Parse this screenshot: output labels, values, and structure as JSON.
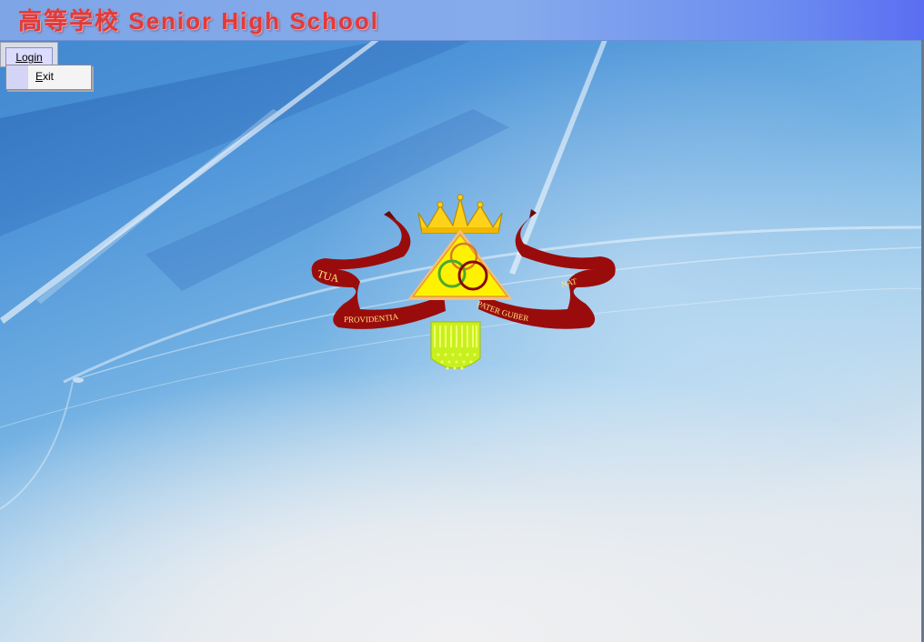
{
  "window": {
    "title": "高等学校 Senior High School"
  },
  "menu": {
    "login_label": "Login",
    "dropdown": {
      "exit_label_first": "E",
      "exit_label_rest": "xit"
    }
  },
  "crest": {
    "ribbon_left_top": "TUA",
    "ribbon_left_bottom": "PROVIDENTIA",
    "ribbon_right_bottom": "PATER GUBER",
    "ribbon_right_top": "NAT"
  },
  "colors": {
    "title_text": "#e23a3a",
    "titlebar": "#86abec",
    "ribbon": "#9a0c0c",
    "triangle": "#fff200",
    "shield": "#c8f01e",
    "crown": "#ffd21a"
  }
}
